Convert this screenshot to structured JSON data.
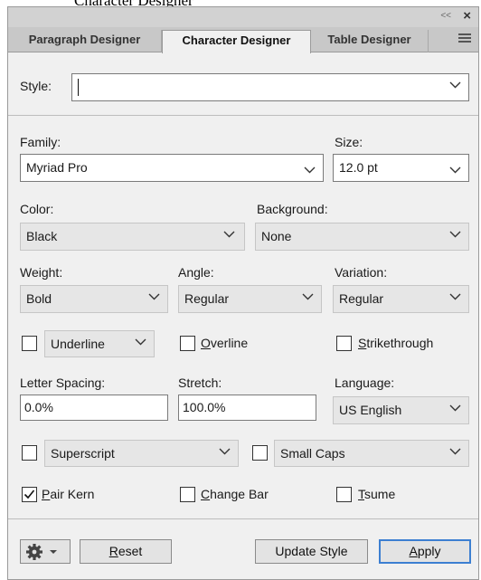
{
  "page": {
    "title": "Character Designer"
  },
  "titlebar": {
    "collapse": "<<",
    "close": "×"
  },
  "tabs": [
    {
      "label": "Paragraph Designer",
      "active": false
    },
    {
      "label": "Character Designer",
      "active": true
    },
    {
      "label": "Table Designer",
      "active": false
    }
  ],
  "style": {
    "label": "Style:",
    "value": ""
  },
  "family": {
    "label": "Family:",
    "value": "Myriad Pro"
  },
  "size": {
    "label": "Size:",
    "value": "12.0 pt"
  },
  "color": {
    "label": "Color:",
    "value": "Black"
  },
  "background": {
    "label": "Background:",
    "value": "None"
  },
  "weight": {
    "label": "Weight:",
    "value": "Bold"
  },
  "angle": {
    "label": "Angle:",
    "value": "Regular"
  },
  "variation": {
    "label": "Variation:",
    "value": "Regular"
  },
  "underline": {
    "checked": false,
    "value": "Underline"
  },
  "overline": {
    "checked": false,
    "label_first": "O",
    "label_rest": "verline"
  },
  "strikethrough": {
    "checked": false,
    "label_first": "S",
    "label_rest": "trikethrough"
  },
  "letter_spacing": {
    "label": "Letter Spacing:",
    "value": "0.0%"
  },
  "stretch": {
    "label": "Stretch:",
    "value": "100.0%"
  },
  "language": {
    "label": "Language:",
    "value": "US English"
  },
  "superscript": {
    "checked": false,
    "value": "Superscript"
  },
  "small_caps": {
    "checked": false,
    "value": "Small Caps"
  },
  "pair_kern": {
    "checked": true,
    "label_first": "P",
    "label_rest": "air Kern"
  },
  "change_bar": {
    "checked": false,
    "label_first": "C",
    "label_rest": "hange Bar"
  },
  "tsume": {
    "checked": false,
    "label_first": "T",
    "label_rest": "sume"
  },
  "buttons": {
    "reset_first": "R",
    "reset_rest": "eset",
    "update_style": "Update Style",
    "apply_first": "A",
    "apply_rest": "pply"
  },
  "icons": {
    "settings": "gear-icon",
    "dropdown": "chevron-down-icon",
    "menu": "hamburger-menu-icon",
    "check": "checkmark-icon"
  },
  "colors": {
    "panel_bg": "#f0f0f0",
    "primary_border": "#3c7fd1"
  }
}
